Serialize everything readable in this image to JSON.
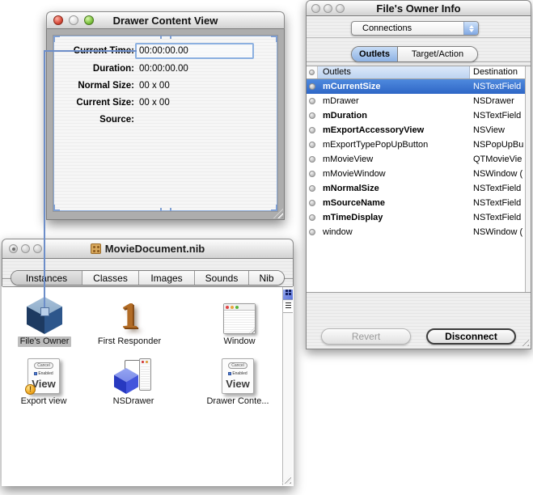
{
  "colors": {
    "selection-top": "#4f8ade",
    "selection-bottom": "#2e66c6",
    "connection-line": "#6d8ec9",
    "field-highlight": "#8cb0e0",
    "tab-selected-top": "#c7dcf6",
    "tab-selected-bottom": "#8db2e4",
    "header-top": "#dce9fa",
    "header-bottom": "#bdd3f0",
    "popup-cap-top": "#cfe2fa",
    "popup-cap-bottom": "#7fa7e3"
  },
  "drawer_window": {
    "title": "Drawer Content View",
    "fields": [
      {
        "label": "Current Time:",
        "value": "00:00:00.00"
      },
      {
        "label": "Duration:",
        "value": "00:00:00.00"
      },
      {
        "label": "Normal Size:",
        "value": "00 x 00"
      },
      {
        "label": "Current Size:",
        "value": "00 x 00"
      },
      {
        "label": "Source:",
        "value": ""
      }
    ]
  },
  "info_panel": {
    "title": "File's Owner Info",
    "popup_value": "Connections",
    "tab_outlets": "Outlets",
    "tab_target_action": "Target/Action",
    "columns": {
      "outlets": "Outlets",
      "destination": "Destination"
    },
    "rows": [
      {
        "outlet": "mCurrentSize",
        "destination": "NSTextField"
      },
      {
        "outlet": "mDrawer",
        "destination": "NSDrawer"
      },
      {
        "outlet": "mDuration",
        "destination": "NSTextField"
      },
      {
        "outlet": "mExportAccessoryView",
        "destination": "NSView"
      },
      {
        "outlet": "mExportTypePopUpButton",
        "destination": "NSPopUpBu"
      },
      {
        "outlet": "mMovieView",
        "destination": "QTMovieVie"
      },
      {
        "outlet": "mMovieWindow",
        "destination": "NSWindow ("
      },
      {
        "outlet": "mNormalSize",
        "destination": "NSTextField"
      },
      {
        "outlet": "mSourceName",
        "destination": "NSTextField"
      },
      {
        "outlet": "mTimeDisplay",
        "destination": "NSTextField"
      },
      {
        "outlet": "window",
        "destination": "NSWindow ("
      }
    ],
    "revert_label": "Revert",
    "disconnect_label": "Disconnect"
  },
  "nib_window": {
    "title": "MovieDocument.nib",
    "tabs": [
      "Instances",
      "Classes",
      "Images",
      "Sounds",
      "Nib"
    ],
    "items": [
      {
        "label": "File's Owner"
      },
      {
        "label": "First Responder"
      },
      {
        "label": "Window"
      },
      {
        "label": "Export view"
      },
      {
        "label": "NSDrawer"
      },
      {
        "label": "Drawer Conte..."
      }
    ],
    "view_icon": {
      "button": "Cancel",
      "checkbox": "Enabled",
      "title": "View"
    },
    "first_responder_glyph": "1",
    "badge_glyph": "!"
  }
}
